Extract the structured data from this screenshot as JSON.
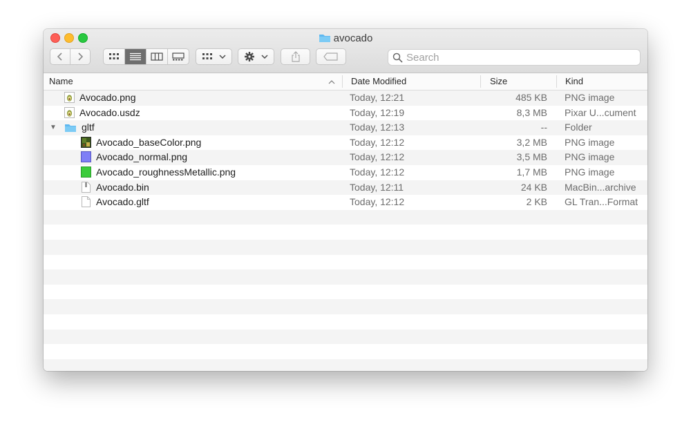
{
  "window": {
    "title": "avocado"
  },
  "toolbar": {
    "search_placeholder": "Search"
  },
  "columns": {
    "name": "Name",
    "date": "Date Modified",
    "size": "Size",
    "kind": "Kind"
  },
  "files": [
    {
      "name": "Avocado.png",
      "date": "Today, 12:21",
      "size": "485 KB",
      "kind": "PNG image",
      "icon": "avocado-image-icon"
    },
    {
      "name": "Avocado.usdz",
      "date": "Today, 12:19",
      "size": "8,3 MB",
      "kind": "Pixar U...cument",
      "icon": "avocado-image-icon"
    },
    {
      "name": "gltf",
      "date": "Today, 12:13",
      "size": "--",
      "kind": "Folder",
      "icon": "folder-icon"
    },
    {
      "name": "Avocado_baseColor.png",
      "date": "Today, 12:12",
      "size": "3,2 MB",
      "kind": "PNG image",
      "icon": "texture-thumbnail-icon"
    },
    {
      "name": "Avocado_normal.png",
      "date": "Today, 12:12",
      "size": "3,5 MB",
      "kind": "PNG image",
      "icon": "normal-map-thumbnail-icon"
    },
    {
      "name": "Avocado_roughnessMetallic.png",
      "date": "Today, 12:12",
      "size": "1,7 MB",
      "kind": "PNG image",
      "icon": "roughness-thumbnail-icon"
    },
    {
      "name": "Avocado.bin",
      "date": "Today, 12:11",
      "size": "24 KB",
      "kind": "MacBin...archive",
      "icon": "archive-file-icon"
    },
    {
      "name": "Avocado.gltf",
      "date": "Today, 12:12",
      "size": "2 KB",
      "kind": "GL Tran...Format",
      "icon": "document-icon"
    }
  ]
}
